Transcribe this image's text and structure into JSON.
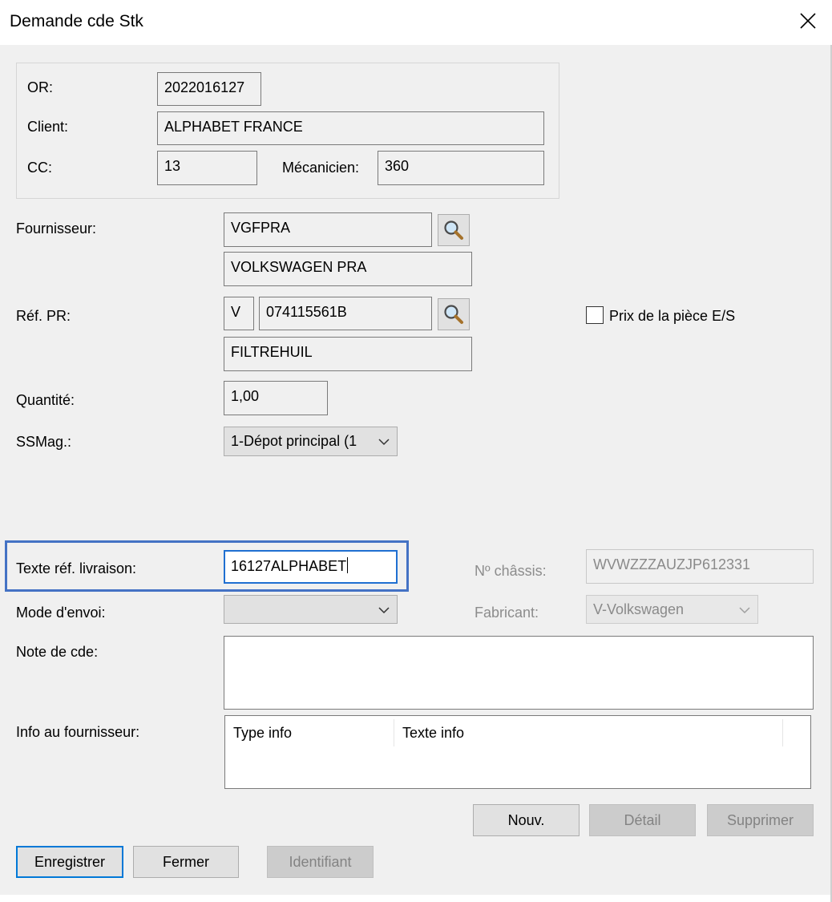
{
  "window": {
    "title": "Demande cde Stk"
  },
  "order": {
    "or_label": "OR:",
    "or_value": "2022016127",
    "client_label": "Client:",
    "client_value": "ALPHABET FRANCE",
    "cc_label": "CC:",
    "cc_value": "13",
    "mecanicien_label": "Mécanicien:",
    "mecanicien_value": "360"
  },
  "supplier": {
    "label": "Fournisseur:",
    "code": "VGFPRA",
    "name": "VOLKSWAGEN PRA"
  },
  "part": {
    "label": "Réf. PR:",
    "prefix": "V",
    "reference": "074115561B",
    "designation": "FILTREHUIL",
    "price_checkbox_label": "Prix de la pièce E/S",
    "price_checkbox_checked": false
  },
  "quantity": {
    "label": "Quantité:",
    "value": "1,00"
  },
  "ssmag": {
    "label": "SSMag.:",
    "selected": "1-Dépot principal (1"
  },
  "delivery": {
    "label": "Texte réf. livraison:",
    "value": "16127ALPHABET",
    "chassis_label": "Nº châssis:",
    "chassis_value": "WVWZZZAUZJP612331"
  },
  "shipping": {
    "label": "Mode d'envoi:",
    "selected": "",
    "manufacturer_label": "Fabricant:",
    "manufacturer_selected": "V-Volkswagen"
  },
  "note": {
    "label": "Note de cde:",
    "value": ""
  },
  "supplier_info": {
    "label": "Info au fournisseur:",
    "columns": [
      "Type info",
      "Texte info"
    ],
    "buttons": {
      "new": "Nouv.",
      "detail": "Détail",
      "delete": "Supprimer"
    }
  },
  "footer": {
    "save": "Enregistrer",
    "close": "Fermer",
    "identifier": "Identifiant"
  },
  "colors": {
    "highlight": "#4472c4",
    "focus": "#1f6fd1",
    "default_button": "#0078d7"
  },
  "icons": {
    "close": "close-icon",
    "search": "magnifier-icon",
    "dropdown": "chevron-down-icon"
  }
}
